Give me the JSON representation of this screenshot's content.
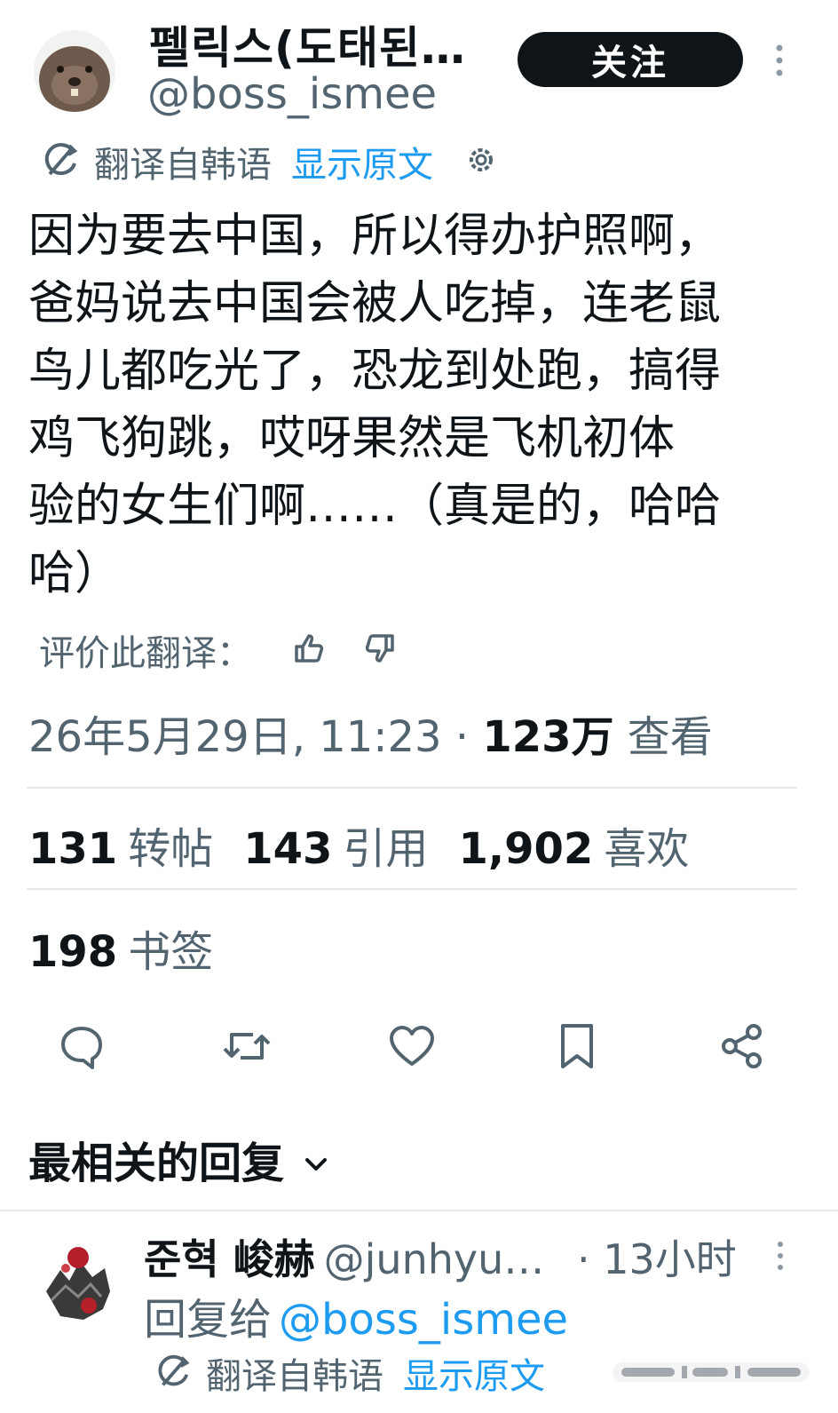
{
  "tweet": {
    "author": {
      "display_name": "펠릭스(도태된…",
      "handle": "@boss_ismee"
    },
    "follow_label": "关注",
    "translation": {
      "label": "翻译自韩语",
      "show_original": "显示原文"
    },
    "text_lines": [
      "因为要去中国，所以得办护照啊，",
      "爸妈说去中国会被人吃掉，连老鼠",
      "鸟儿都吃光了，恐龙到处跑，搞得",
      "鸡飞狗跳，哎呀果然是飞机初体",
      "验的女生们啊……（真是的，哈哈",
      "哈）"
    ],
    "rate_label": "评价此翻译：",
    "timestamp": "26年5月29日, 11:23",
    "separator": " · ",
    "views_count": "123万",
    "views_label": "查看",
    "stats": {
      "reposts_count": "131",
      "reposts_label": "转帖",
      "quotes_count": "143",
      "quotes_label": "引用",
      "likes_count": "1,902",
      "likes_label": "喜欢",
      "bookmarks_count": "198",
      "bookmarks_label": "书签"
    },
    "actions": [
      "reply-icon",
      "retweet-icon",
      "heart-icon",
      "bookmark-icon",
      "share-icon"
    ]
  },
  "replies": {
    "header": "最相关的回复",
    "items": [
      {
        "display_name": "준혁 峻赫",
        "handle": "@junhyu…",
        "time": "· 13小时",
        "reply_to_label": "回复给",
        "reply_to_handle": "@boss_ismee",
        "translation_label": "翻译自韩语",
        "show_original": "显示原文"
      }
    ]
  },
  "colors": {
    "text_primary": "#0f1419",
    "text_secondary": "#536471",
    "accent": "#1d9bf0",
    "divider": "#e6e9ec"
  }
}
